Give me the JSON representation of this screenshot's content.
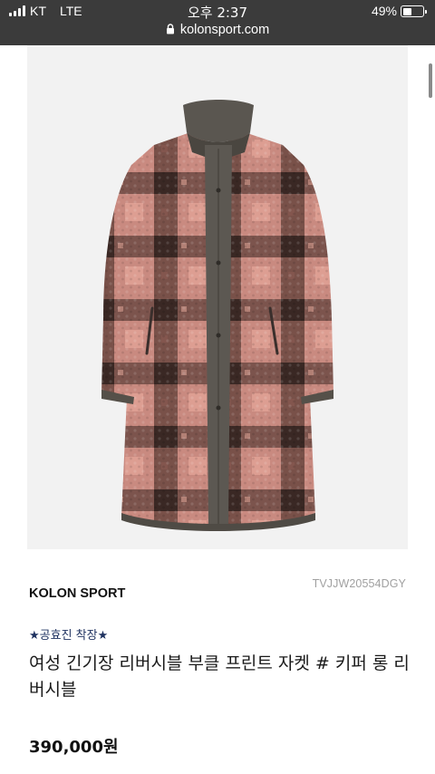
{
  "status_bar": {
    "carrier": "KT",
    "network": "LTE",
    "time": "오후 2:37",
    "battery_percent": "49%",
    "battery_level": 0.49
  },
  "browser": {
    "url": "kolonsport.com"
  },
  "product": {
    "image_icon": "coat-product-photo",
    "sku": "TVJJW20554DGY",
    "brand": "KOLON SPORT",
    "tag": "★공효진 착장★",
    "title": "여성 긴기장 리버시블 부클 프린트 자켓 # 키퍼 롱 리버시블",
    "price": "390,000원"
  },
  "colors": {
    "top_bar": "#3b3b3b",
    "tag_text": "#1f3260",
    "sku_text": "#a0a0a0"
  }
}
